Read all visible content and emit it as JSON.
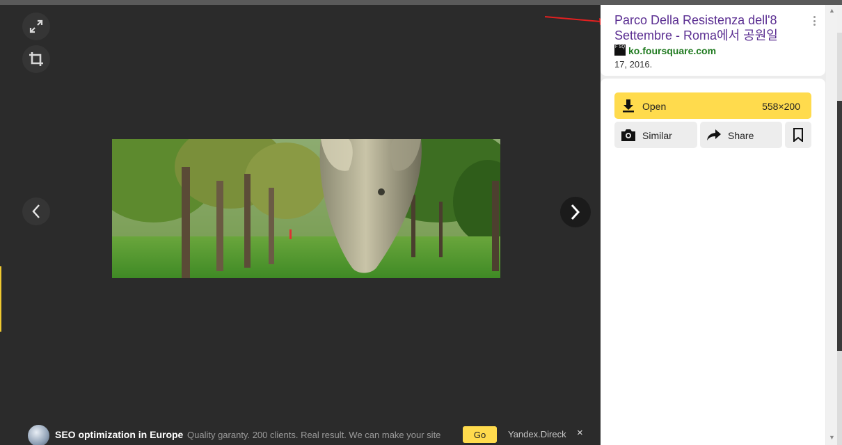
{
  "result": {
    "title": "Parco Della Resistenza dell'8 Settembre - Roma에서 공원일",
    "favicon_text": "F SQ",
    "domain": "ko.foursquare.com",
    "date": "17, 2016."
  },
  "actions": {
    "open_label": "Open",
    "open_size": "558×200",
    "similar_label": "Similar",
    "share_label": "Share"
  },
  "ad": {
    "title": "SEO optimization in Europe",
    "text": "Quality garanty. 200 clients. Real result. We can make your site",
    "go_label": "Go",
    "source": "Yandex.Direck",
    "close_glyph": "×"
  },
  "scroll": {
    "up_glyph": "▲",
    "down_glyph": "▼"
  },
  "colors": {
    "accent_yellow": "#ffdb4d",
    "title_purple": "#5a2d91",
    "domain_green": "#1f7a1f",
    "viewer_bg": "#2b2b2b",
    "annotation_red": "#e32020"
  },
  "icons": [
    "expand-icon",
    "crop-icon",
    "chevron-left-icon",
    "chevron-right-icon",
    "download-icon",
    "camera-icon",
    "share-arrow-icon",
    "bookmark-icon",
    "kebab-menu-icon"
  ]
}
